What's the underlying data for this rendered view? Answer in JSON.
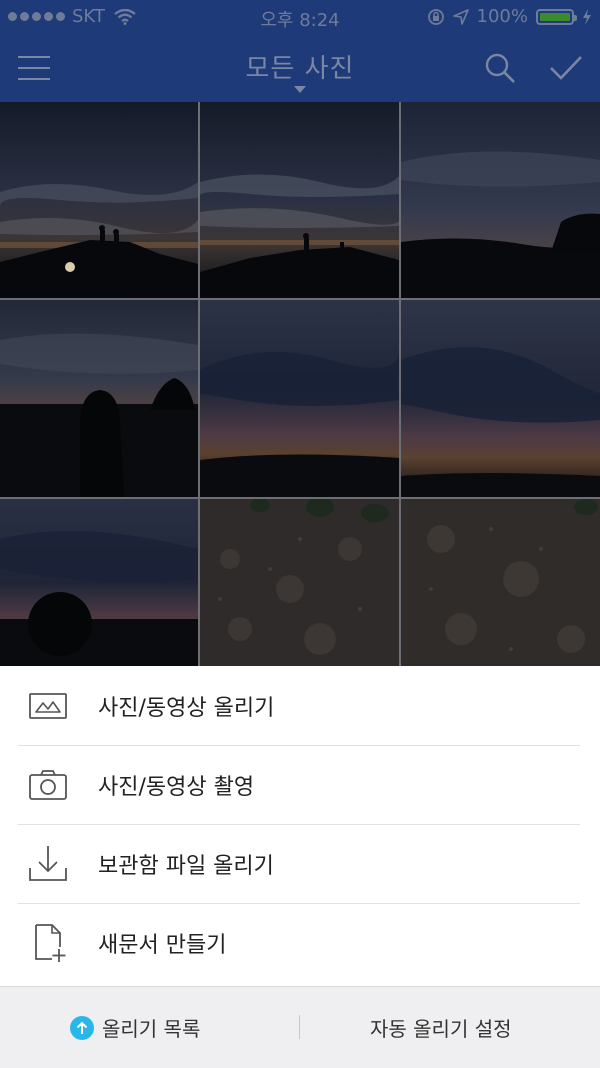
{
  "status_bar": {
    "carrier": "SKT",
    "time": "오후 8:24",
    "battery": "100%",
    "battery_level": 1.0
  },
  "nav": {
    "title": "모든 사진",
    "left_icon": "menu-icon",
    "right_icons": [
      "search-icon",
      "checkmark-icon"
    ]
  },
  "grid": {
    "photos": [
      "sunset-boardwalk-silhouettes",
      "sunset-boardwalk-silhouettes-2",
      "dusk-sky-over-landscape",
      "dusk-silhouette-person",
      "dusk-clouds-purple-horizon",
      "dusk-clouds-purple-horizon-2",
      "dusk-silhouette-head",
      "ground-gravel-leaves",
      "ground-gravel"
    ]
  },
  "actions": [
    {
      "label": "사진/동영상 올리기",
      "icon": "photo-upload-icon"
    },
    {
      "label": "사진/동영상 촬영",
      "icon": "camera-icon"
    },
    {
      "label": "보관함 파일 올리기",
      "icon": "download-tray-icon"
    },
    {
      "label": "새문서 만들기",
      "icon": "new-document-icon"
    }
  ],
  "bottom_bar": {
    "upload_list": "올리기 목록",
    "auto_upload": "자동 올리기 설정",
    "accent_color": "#29b6ea"
  }
}
